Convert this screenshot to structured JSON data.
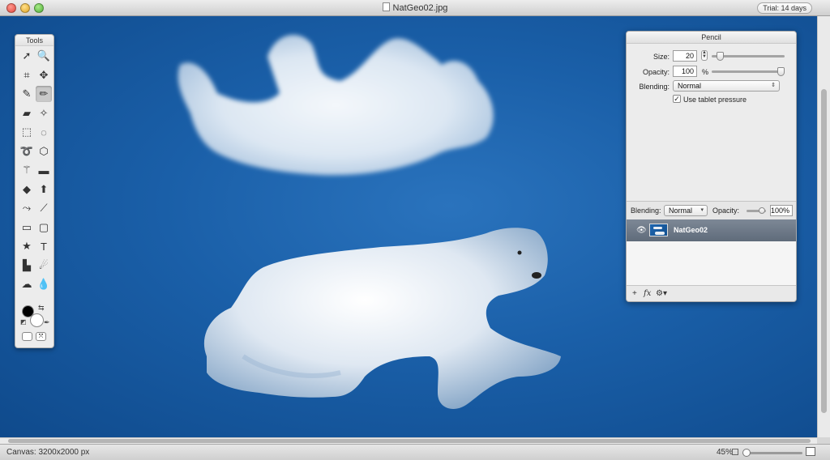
{
  "window": {
    "title": "NatGeo02.jpg",
    "trial_badge": "Trial: 14 days"
  },
  "tools": {
    "title": "Tools",
    "items": [
      {
        "name": "select-arrow-icon",
        "glyph": "➚"
      },
      {
        "name": "zoom-tool-icon",
        "glyph": "🔍"
      },
      {
        "name": "crop-tool-icon",
        "glyph": "⌗"
      },
      {
        "name": "move-tool-icon",
        "glyph": "✥"
      },
      {
        "name": "brush-tool-icon",
        "glyph": "✎"
      },
      {
        "name": "pencil-tool-icon",
        "glyph": "✏"
      },
      {
        "name": "eraser-tool-icon",
        "glyph": "▰"
      },
      {
        "name": "magic-eraser-icon",
        "glyph": "✧"
      },
      {
        "name": "rect-select-icon",
        "glyph": "⬚"
      },
      {
        "name": "ellipse-select-icon",
        "glyph": "◌"
      },
      {
        "name": "lasso-icon",
        "glyph": "➰"
      },
      {
        "name": "polygon-lasso-icon",
        "glyph": "⬡"
      },
      {
        "name": "magic-wand-icon",
        "glyph": "⚚"
      },
      {
        "name": "rectangle-shape-icon",
        "glyph": "▬"
      },
      {
        "name": "paint-bucket-icon",
        "glyph": "◆"
      },
      {
        "name": "arrow-up-icon",
        "glyph": "⬆"
      },
      {
        "name": "bezier-pen-icon",
        "glyph": "⤳"
      },
      {
        "name": "line-tool-icon",
        "glyph": "⟋"
      },
      {
        "name": "rect-tool-icon",
        "glyph": "▭"
      },
      {
        "name": "rounded-rect-icon",
        "glyph": "▢"
      },
      {
        "name": "star-tool-icon",
        "glyph": "★"
      },
      {
        "name": "text-tool-icon",
        "glyph": "T"
      },
      {
        "name": "clone-stamp-icon",
        "glyph": "▙"
      },
      {
        "name": "smudge-tool-icon",
        "glyph": "☄"
      },
      {
        "name": "cloud-shape-icon",
        "glyph": "☁"
      },
      {
        "name": "blur-drop-icon",
        "glyph": "💧"
      }
    ]
  },
  "colors": {
    "foreground": "#000000",
    "background": "#ffffff",
    "canvas_blue": "#1a5fa8"
  },
  "pencil_panel": {
    "title": "Pencil",
    "size_label": "Size:",
    "size_value": "20",
    "size_fraction": 0.08,
    "opacity_label": "Opacity:",
    "opacity_value": "100",
    "opacity_unit": "%",
    "opacity_fraction": 1.0,
    "blending_label": "Blending:",
    "blending_value": "Normal",
    "tablet_pressure_label": "Use tablet pressure",
    "tablet_pressure_checked": true
  },
  "layers_panel": {
    "blending_label": "Blending:",
    "blending_value": "Normal",
    "opacity_label": "Opacity:",
    "opacity_value": "100%",
    "opacity_fraction": 1.0,
    "layers": [
      {
        "name": "NatGeo02",
        "visible": true
      }
    ],
    "footer": {
      "add": "+",
      "fx": "fx",
      "gear": "⚙▾"
    }
  },
  "statusbar": {
    "canvas_info": "Canvas: 3200x2000 px",
    "zoom": "45%",
    "zoom_fraction": 0.0
  }
}
